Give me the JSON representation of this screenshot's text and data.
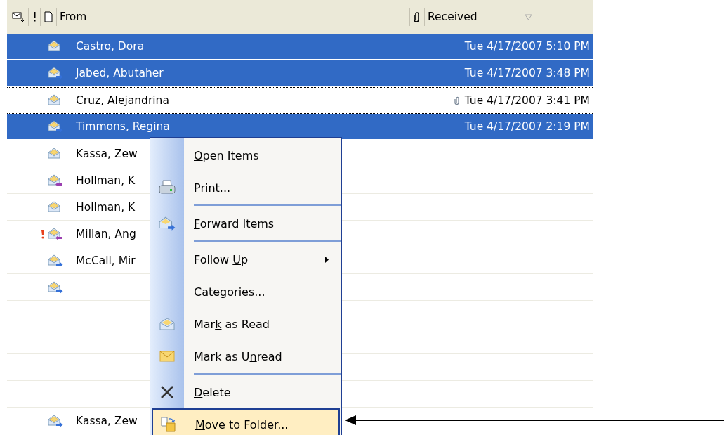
{
  "header": {
    "from": "From",
    "received": "Received"
  },
  "rows": [
    {
      "kind": "read",
      "from": "Castro, Dora",
      "received": "Tue 4/17/2007 5:10 PM",
      "selected": true,
      "focused": false,
      "important": false,
      "attachment": false
    },
    {
      "kind": "forwarded",
      "from": "Jabed,  Abutaher",
      "received": "Tue 4/17/2007 3:48 PM",
      "selected": true,
      "focused": false,
      "important": false,
      "attachment": false
    },
    {
      "kind": "read",
      "from": "Cruz, Alejandrina",
      "received": "Tue 4/17/2007 3:41 PM",
      "selected": false,
      "focused": true,
      "important": false,
      "attachment": true
    },
    {
      "kind": "forwarded",
      "from": "Timmons, Regina",
      "received": "Tue 4/17/2007 2:19 PM",
      "selected": true,
      "focused": false,
      "important": false,
      "attachment": false
    },
    {
      "kind": "read",
      "from": "Kassa, Zew",
      "selected": false,
      "focused": false,
      "important": false,
      "attachment": false
    },
    {
      "kind": "replied",
      "from": "Hollman, K",
      "selected": false,
      "focused": false,
      "important": false,
      "attachment": false
    },
    {
      "kind": "read",
      "from": "Hollman, K",
      "selected": false,
      "focused": false,
      "important": false,
      "attachment": false
    },
    {
      "kind": "replied",
      "from": "Millan, Ang",
      "selected": false,
      "focused": false,
      "important": true,
      "attachment": false
    },
    {
      "kind": "forwarded",
      "from": "McCall, Mir",
      "selected": false,
      "focused": false,
      "important": false,
      "attachment": false
    },
    {
      "kind": "forwarded",
      "selected": false,
      "focused": false,
      "important": false,
      "attachment": false
    },
    {
      "kind": "empty",
      "selected": false,
      "focused": false,
      "important": false,
      "attachment": false
    },
    {
      "kind": "empty",
      "selected": false,
      "focused": false,
      "important": false,
      "attachment": false
    },
    {
      "kind": "empty",
      "selected": false,
      "focused": false,
      "important": false,
      "attachment": false
    },
    {
      "kind": "empty",
      "selected": false,
      "focused": false,
      "important": false,
      "attachment": false
    },
    {
      "kind": "forwarded",
      "from": "Kassa, Zew",
      "selected": false,
      "focused": false,
      "important": false,
      "attachment": false
    }
  ],
  "context_menu": [
    {
      "kind": "item",
      "key": "O",
      "after": "pen Items",
      "selected": false,
      "submenu": false
    },
    {
      "kind": "print",
      "key": "P",
      "after": "rint...",
      "selected": false,
      "submenu": false
    },
    {
      "kind": "separator"
    },
    {
      "kind": "forward",
      "key": "F",
      "after": "orward Items",
      "selected": false,
      "submenu": false
    },
    {
      "kind": "separator"
    },
    {
      "kind": "item",
      "before": "Follow ",
      "key": "U",
      "after": "p",
      "selected": false,
      "submenu": true
    },
    {
      "kind": "item",
      "before": "Categor",
      "key": "i",
      "after": "es...",
      "selected": false,
      "submenu": false
    },
    {
      "kind": "read",
      "before": "Mar",
      "key": "k",
      "after": " as Read",
      "selected": false,
      "submenu": false
    },
    {
      "kind": "unread",
      "before": "Mark as U",
      "key": "n",
      "after": "read",
      "selected": false,
      "submenu": false
    },
    {
      "kind": "separator"
    },
    {
      "kind": "delete",
      "key": "D",
      "after": "elete",
      "selected": false,
      "submenu": false
    },
    {
      "kind": "move",
      "key": "M",
      "after": "ove to Folder...",
      "selected": true,
      "submenu": false
    }
  ]
}
